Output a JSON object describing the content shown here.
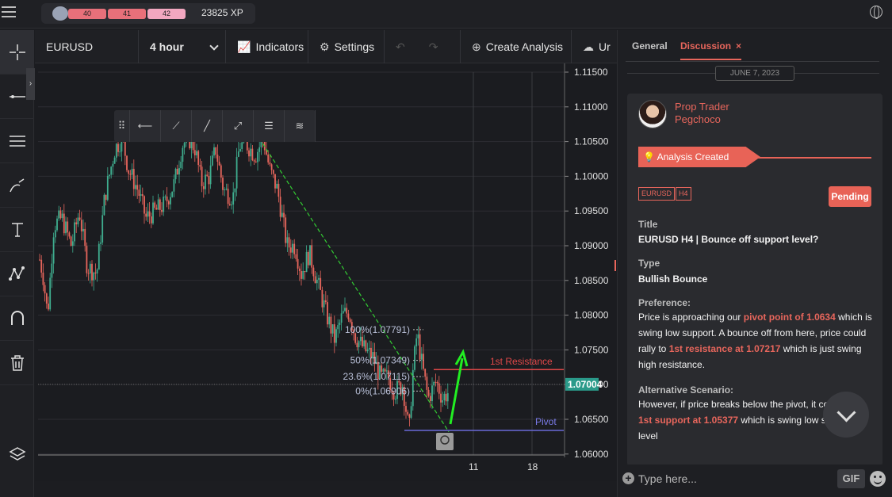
{
  "topbar": {
    "levels": [
      "40",
      "41",
      "42"
    ],
    "xp": "23825 XP"
  },
  "toolbar": {
    "symbol": "EURUSD",
    "timeframe": "4 hour",
    "indicators": "Indicators",
    "settings": "Settings",
    "create_analysis": "Create Analysis",
    "upload": "Ur"
  },
  "chart": {
    "price_ticks": [
      "1.11500",
      "1.11000",
      "1.10500",
      "1.10000",
      "1.09500",
      "1.09000",
      "1.08500",
      "1.08000",
      "1.07500",
      "1.07000",
      "1.06500",
      "1.06000"
    ],
    "current_price": "1.07004",
    "date_ticks": [
      "11",
      "18"
    ],
    "fib_labels": [
      "100%(1.07791)",
      "50%(1.07349)",
      "23.6%(1.07115)",
      "0%(1.06906)"
    ],
    "resistance_label": "1st Resistance",
    "pivot_label": "Pivot",
    "colors": {
      "up": "#3fae8f",
      "down": "#e8665c",
      "resistance": "#e04848",
      "pivot": "#6a6ad8",
      "trend": "#33cc33",
      "arrow": "#22ee22"
    }
  },
  "panel": {
    "tabs": {
      "general": "General",
      "discussion": "Discussion"
    },
    "date": "JUNE 7, 2023",
    "author_role": "Prop Trader",
    "author_name": "Pegchoco",
    "banner": "Analysis Created",
    "tags": [
      "EURUSD",
      "H4"
    ],
    "status": "Pending",
    "title_label": "Title",
    "title_value": "EURUSD H4 | Bounce off support level?",
    "type_label": "Type",
    "type_value": "Bullish Bounce",
    "pref_label": "Preference:",
    "pref_parts": [
      "Price is approaching our ",
      "pivot point of 1.0634",
      " which is swing low support. A bounce off from here, price could rally to ",
      "1st resistance at 1.07217",
      " which is just swing high resistance."
    ],
    "alt_label": "Alternative Scenario:",
    "alt_parts": [
      "However, if price breaks below the pivot, it co",
      "1st support at 1.05377",
      " which is swing low su",
      "level"
    ],
    "composer_placeholder": "Type here...",
    "gif": "GIF"
  }
}
